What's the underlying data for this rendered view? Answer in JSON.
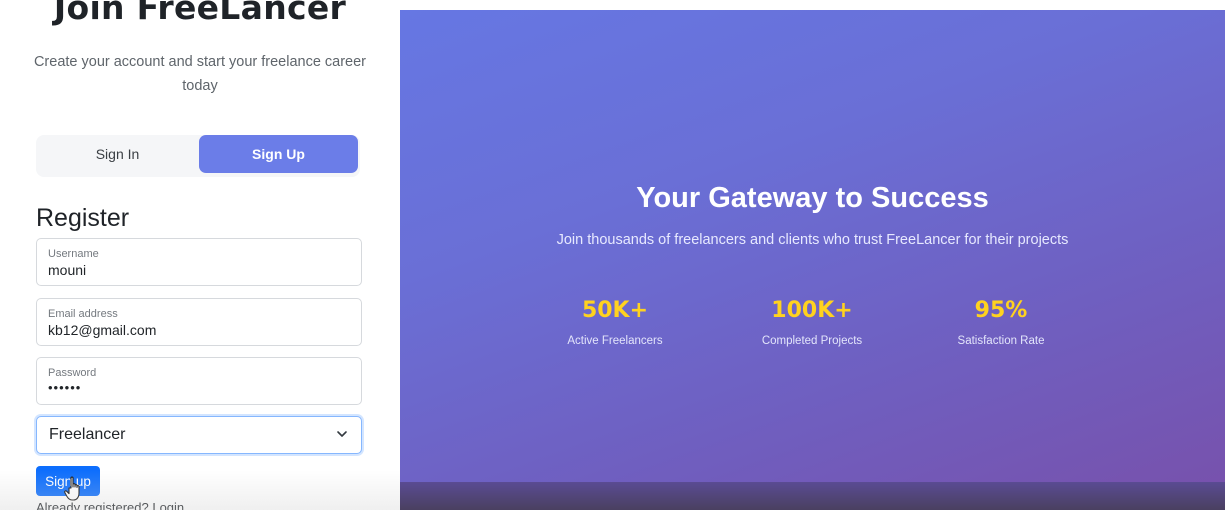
{
  "brand": {
    "title": "Join FreeLancer",
    "subtitle": "Create your account and start your freelance career today"
  },
  "auth_tabs": {
    "signin_label": "Sign In",
    "signup_label": "Sign Up",
    "active": "Sign Up"
  },
  "form": {
    "heading": "Register",
    "username": {
      "label": "Username",
      "value": "mouni"
    },
    "email": {
      "label": "Email address",
      "value": "kb12@gmail.com"
    },
    "password": {
      "label": "Password",
      "value": "••••••"
    },
    "role": {
      "selected": "Freelancer"
    },
    "submit_label": "Sign up",
    "login_prompt": "Already registered? Login"
  },
  "hero": {
    "title": "Your Gateway to Success",
    "subtitle": "Join thousands of freelancers and clients who trust FreeLancer for their projects",
    "stats": [
      {
        "value": "50K+",
        "label": "Active Freelancers"
      },
      {
        "value": "100K+",
        "label": "Completed Projects"
      },
      {
        "value": "95%",
        "label": "Satisfaction Rate"
      }
    ]
  },
  "colors": {
    "accent": "#6b7de8",
    "primary_button": "#0d6efd",
    "stat_number": "#ffd21f",
    "hero_gradient_start": "#6677e3",
    "hero_gradient_end": "#7752ad"
  },
  "icons": {
    "select_chevron": "chevron-down-icon",
    "cursor": "hand-pointer-cursor-icon"
  }
}
